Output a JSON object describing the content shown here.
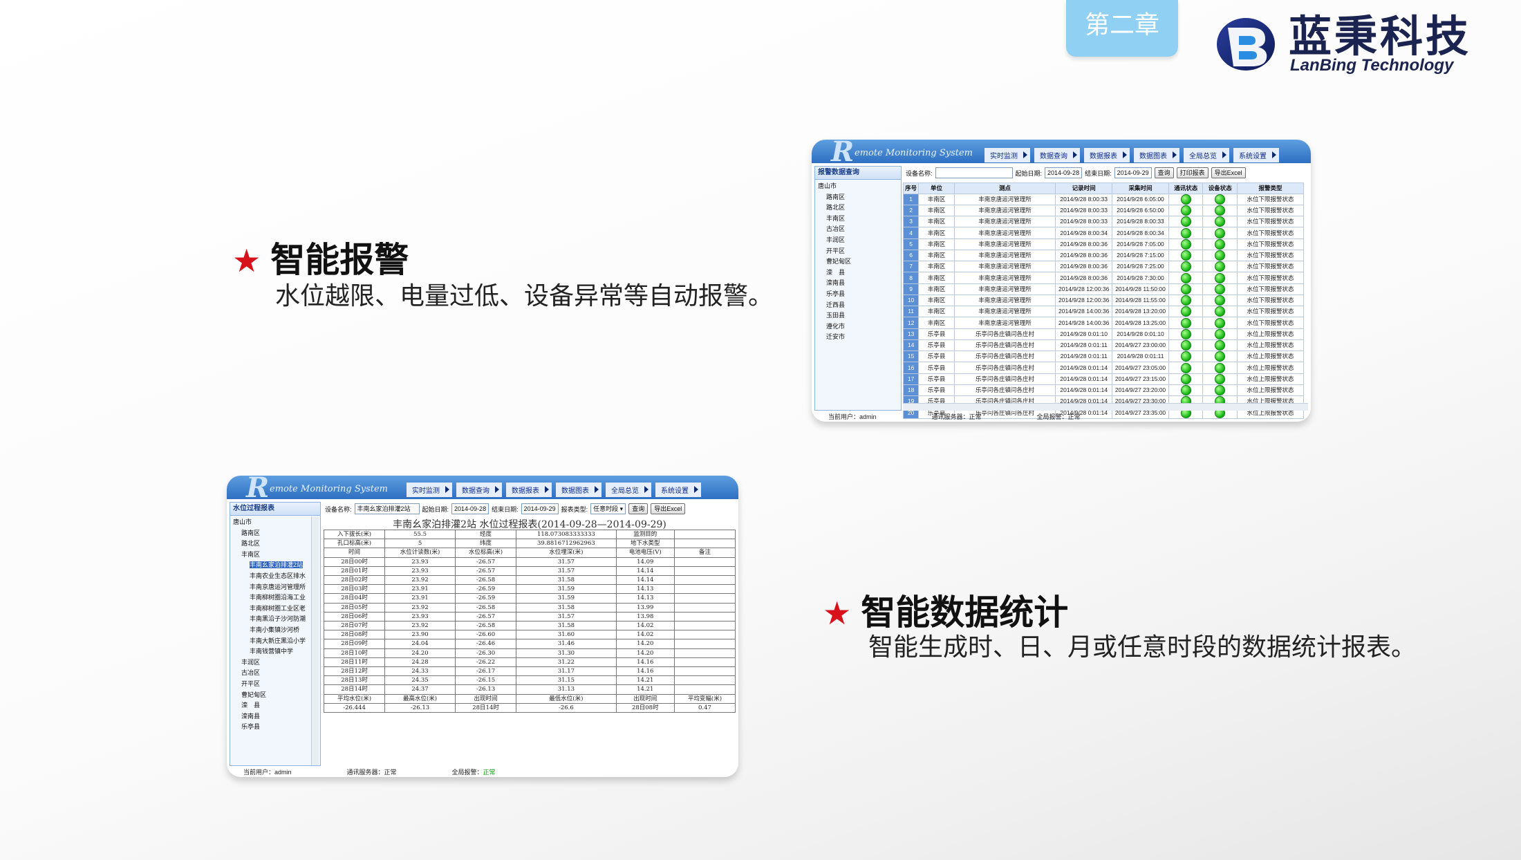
{
  "header": {
    "chapter_tab": "第二章",
    "logo_cn": "蓝秉科技",
    "logo_en": "LanBing Technology"
  },
  "features": [
    {
      "star": "★",
      "title": "智能报警",
      "desc": "水位越限、电量过低、设备异常等自动报警。"
    },
    {
      "star": "★",
      "title": "智能数据统计",
      "desc": "智能生成时、日、月或任意时段的数据统计报表。"
    }
  ],
  "alarm_screen": {
    "app_logo": "R",
    "system_name": "emote Monitoring System",
    "nav": [
      "实时监测",
      "数据查询",
      "数据报表",
      "数据图表",
      "全局总览",
      "系统设置"
    ],
    "sidebar_title": "报警数据查询",
    "tree": [
      "唐山市",
      "路南区",
      "路北区",
      "丰南区",
      "古冶区",
      "丰润区",
      "开平区",
      "曹妃甸区",
      "滦　县",
      "滦南县",
      "乐亭县",
      "迁西县",
      "玉田县",
      "遵化市",
      "迁安市"
    ],
    "filter": {
      "device_label": "设备名称:",
      "device_value": "",
      "start_label": "起始日期:",
      "start_value": "2014-09-28",
      "end_label": "结束日期:",
      "end_value": "2014-09-29",
      "query_btn": "查询",
      "print_btn": "打印报表",
      "excel_btn": "导出Excel"
    },
    "columns": [
      "序号",
      "单位",
      "测点",
      "记录时间",
      "采集时间",
      "通讯状态",
      "设备状态",
      "报警类型"
    ],
    "rows": [
      [
        "1",
        "丰南区",
        "丰南京唐运河管理所",
        "2014/9/28 8:00:33",
        "2014/9/28 6:05:00",
        "水位下限报警状态"
      ],
      [
        "2",
        "丰南区",
        "丰南京唐运河管理所",
        "2014/9/28 8:00:33",
        "2014/9/28 6:50:00",
        "水位下限报警状态"
      ],
      [
        "3",
        "丰南区",
        "丰南京唐运河管理所",
        "2014/9/28 8:00:33",
        "2014/9/28 8:00:33",
        "水位下限报警状态"
      ],
      [
        "4",
        "丰南区",
        "丰南京唐运河管理所",
        "2014/9/28 8:00:34",
        "2014/9/28 8:00:34",
        "水位下限报警状态"
      ],
      [
        "5",
        "丰南区",
        "丰南京唐运河管理所",
        "2014/9/28 8:00:36",
        "2014/9/28 7:05:00",
        "水位下限报警状态"
      ],
      [
        "6",
        "丰南区",
        "丰南京唐运河管理所",
        "2014/9/28 8:00:36",
        "2014/9/28 7:15:00",
        "水位下限报警状态"
      ],
      [
        "7",
        "丰南区",
        "丰南京唐运河管理所",
        "2014/9/28 8:00:36",
        "2014/9/28 7:25:00",
        "水位下限报警状态"
      ],
      [
        "8",
        "丰南区",
        "丰南京唐运河管理所",
        "2014/9/28 8:00:36",
        "2014/9/28 7:30:00",
        "水位下限报警状态"
      ],
      [
        "9",
        "丰南区",
        "丰南京唐运河管理所",
        "2014/9/28 12:00:36",
        "2014/9/28 11:50:00",
        "水位下限报警状态"
      ],
      [
        "10",
        "丰南区",
        "丰南京唐运河管理所",
        "2014/9/28 12:00:36",
        "2014/9/28 11:55:00",
        "水位下限报警状态"
      ],
      [
        "11",
        "丰南区",
        "丰南京唐运河管理所",
        "2014/9/28 14:00:36",
        "2014/9/28 13:20:00",
        "水位下限报警状态"
      ],
      [
        "12",
        "丰南区",
        "丰南京唐运河管理所",
        "2014/9/28 14:00:36",
        "2014/9/28 13:25:00",
        "水位下限报警状态"
      ],
      [
        "13",
        "乐亭县",
        "乐亭闫各庄镇闫各庄村",
        "2014/9/28 0:01:10",
        "2014/9/28 0:01:10",
        "水位上限报警状态"
      ],
      [
        "14",
        "乐亭县",
        "乐亭闫各庄镇闫各庄村",
        "2014/9/28 0:01:11",
        "2014/9/27 23:00:00",
        "水位上限报警状态"
      ],
      [
        "15",
        "乐亭县",
        "乐亭闫各庄镇闫各庄村",
        "2014/9/28 0:01:11",
        "2014/9/28 0:01:11",
        "水位上限报警状态"
      ],
      [
        "16",
        "乐亭县",
        "乐亭闫各庄镇闫各庄村",
        "2014/9/28 0:01:14",
        "2014/9/27 23:05:00",
        "水位上限报警状态"
      ],
      [
        "17",
        "乐亭县",
        "乐亭闫各庄镇闫各庄村",
        "2014/9/28 0:01:14",
        "2014/9/27 23:15:00",
        "水位上限报警状态"
      ],
      [
        "18",
        "乐亭县",
        "乐亭闫各庄镇闫各庄村",
        "2014/9/28 0:01:14",
        "2014/9/27 23:20:00",
        "水位上限报警状态"
      ],
      [
        "19",
        "乐亭县",
        "乐亭闫各庄镇闫各庄村",
        "2014/9/28 0:01:14",
        "2014/9/27 23:30:00",
        "水位上限报警状态"
      ],
      [
        "20",
        "乐亭县",
        "乐亭闫各庄镇闫各庄村",
        "2014/9/28 0:01:14",
        "2014/9/27 23:35:00",
        "水位上限报警状态"
      ]
    ],
    "status": {
      "user": "当前用户：admin",
      "server": "通讯服务器：正常",
      "alarm": "全局报警：正常"
    }
  },
  "report_screen": {
    "app_logo": "R",
    "system_name": "emote Monitoring System",
    "nav": [
      "实时监测",
      "数据查询",
      "数据报表",
      "数据图表",
      "全局总览",
      "系统设置"
    ],
    "sidebar_title": "水位过程报表",
    "tree": [
      {
        "label": "唐山市",
        "level": 0
      },
      {
        "label": "路南区",
        "level": 1
      },
      {
        "label": "路北区",
        "level": 1
      },
      {
        "label": "丰南区",
        "level": 1
      },
      {
        "label": "丰南幺家泊排灌2站",
        "level": 2,
        "selected": true
      },
      {
        "label": "丰南农业生态区排水",
        "level": 2
      },
      {
        "label": "丰南京唐运河管理所",
        "level": 2
      },
      {
        "label": "丰南柳树圈沿海工业",
        "level": 2
      },
      {
        "label": "丰南柳树圈工业区老",
        "level": 2
      },
      {
        "label": "丰南黑沿子沙河防潮",
        "level": 2
      },
      {
        "label": "丰南小集镇沙河桥",
        "level": 2
      },
      {
        "label": "丰南大新庄黑沿小学",
        "level": 2
      },
      {
        "label": "丰南钱营镇中学",
        "level": 2
      },
      {
        "label": "丰润区",
        "level": 1
      },
      {
        "label": "古冶区",
        "level": 1
      },
      {
        "label": "开平区",
        "level": 1
      },
      {
        "label": "曹妃甸区",
        "level": 1
      },
      {
        "label": "滦　县",
        "level": 1
      },
      {
        "label": "滦南县",
        "level": 1
      },
      {
        "label": "乐亭县",
        "level": 1
      }
    ],
    "filter": {
      "device_label": "设备名称:",
      "device_value": "丰南幺家泊排灌2站",
      "start_label": "起始日期:",
      "start_value": "2014-09-28",
      "end_label": "结束日期:",
      "end_value": "2014-09-29",
      "type_label": "报表类型:",
      "type_value": "任意时段",
      "query_btn": "查询",
      "excel_btn": "导出Excel"
    },
    "report_title": "丰南幺家泊排灌2站  水位过程报表(2014-09-28—2014-09-29)",
    "meta_rows": [
      [
        "入下拔长(米)",
        "55.5",
        "经度",
        "118.073083333333",
        "监测目的",
        ""
      ],
      [
        "孔口标高(米)",
        "5",
        "纬度",
        "39.8816712962963",
        "地下水类型",
        ""
      ]
    ],
    "columns": [
      "时间",
      "水位计读数(米)",
      "水位标高(米)",
      "水位埋深(米)",
      "电池电压(V)",
      "备注"
    ],
    "rows": [
      [
        "28日00时",
        "23.93",
        "-26.57",
        "31.57",
        "14.09",
        ""
      ],
      [
        "28日01时",
        "23.93",
        "-26.57",
        "31.57",
        "14.14",
        ""
      ],
      [
        "28日02时",
        "23.92",
        "-26.58",
        "31.58",
        "14.14",
        ""
      ],
      [
        "28日03时",
        "23.91",
        "-26.59",
        "31.59",
        "14.13",
        ""
      ],
      [
        "28日04时",
        "23.91",
        "-26.59",
        "31.59",
        "14.13",
        ""
      ],
      [
        "28日05时",
        "23.92",
        "-26.58",
        "31.58",
        "13.99",
        ""
      ],
      [
        "28日06时",
        "23.93",
        "-26.57",
        "31.57",
        "13.98",
        ""
      ],
      [
        "28日07时",
        "23.92",
        "-26.58",
        "31.58",
        "14.02",
        ""
      ],
      [
        "28日08时",
        "23.90",
        "-26.60",
        "31.60",
        "14.02",
        ""
      ],
      [
        "28日09时",
        "24.04",
        "-26.46",
        "31.46",
        "14.20",
        ""
      ],
      [
        "28日10时",
        "24.20",
        "-26.30",
        "31.30",
        "14.20",
        ""
      ],
      [
        "28日11时",
        "24.28",
        "-26.22",
        "31.22",
        "14.16",
        ""
      ],
      [
        "28日12时",
        "24.33",
        "-26.17",
        "31.17",
        "14.16",
        ""
      ],
      [
        "28日13时",
        "24.35",
        "-26.15",
        "31.15",
        "14.21",
        ""
      ],
      [
        "28日14时",
        "24.37",
        "-26.13",
        "31.13",
        "14.21",
        ""
      ]
    ],
    "summary_header": [
      "平均水位(米)",
      "最高水位(米)",
      "出现时间",
      "最低水位(米)",
      "出现时间",
      "平均变幅(米)"
    ],
    "summary_values": [
      "-26.444",
      "-26.13",
      "28日14时",
      "-26.6",
      "28日08时",
      "0.47"
    ],
    "status": {
      "user": "当前用户：admin",
      "server": "通讯服务器：正常",
      "alarm": "全局报警：",
      "alarm_state": "正常"
    }
  }
}
